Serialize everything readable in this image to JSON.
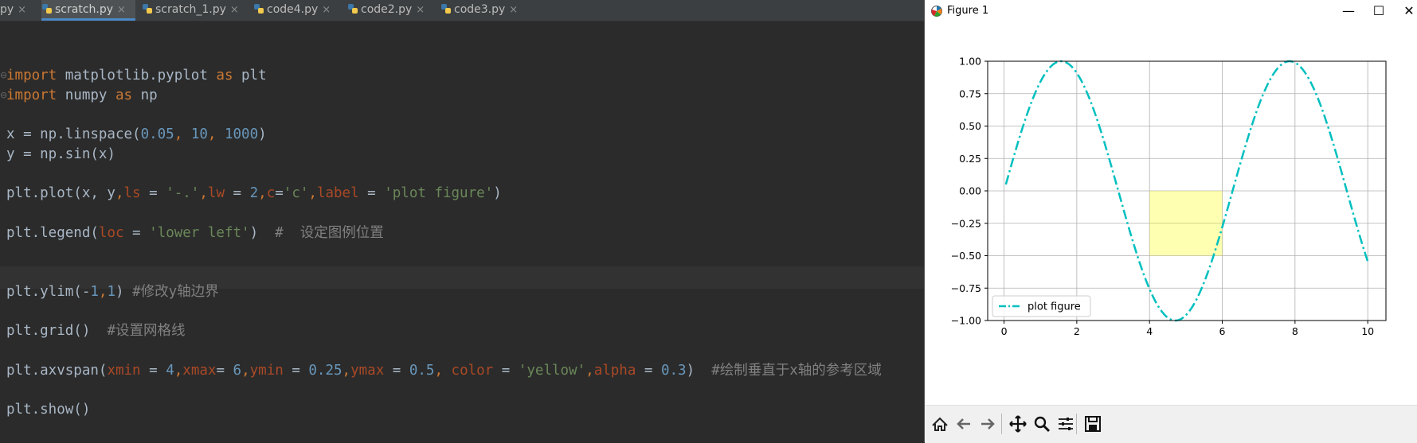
{
  "tabs": [
    {
      "label": "py",
      "icon": "python-file-icon",
      "active": false
    },
    {
      "label": "scratch.py",
      "icon": "python-file-icon",
      "active": true
    },
    {
      "label": "scratch_1.py",
      "icon": "python-file-icon",
      "active": false
    },
    {
      "label": "code4.py",
      "icon": "python-file-icon",
      "active": false
    },
    {
      "label": "code2.py",
      "icon": "python-file-icon",
      "active": false
    },
    {
      "label": "code3.py",
      "icon": "python-file-icon",
      "active": false
    }
  ],
  "tab_close_glyph": "×",
  "code_lines": [
    [
      [
        "kw",
        "import"
      ],
      [
        "t",
        " matplotlib.pyplot "
      ],
      [
        "kw",
        "as"
      ],
      [
        "t",
        " plt"
      ]
    ],
    [
      [
        "kw",
        "import"
      ],
      [
        "t",
        " numpy "
      ],
      [
        "kw",
        "as"
      ],
      [
        "t",
        " np"
      ]
    ],
    [],
    [
      [
        "t",
        "x = np.linspace("
      ],
      [
        "num",
        "0.05"
      ],
      [
        "kw",
        ", "
      ],
      [
        "num",
        "10"
      ],
      [
        "kw",
        ", "
      ],
      [
        "num",
        "1000"
      ],
      [
        "t",
        ")"
      ]
    ],
    [
      [
        "t",
        "y = np.sin(x)"
      ]
    ],
    [],
    [
      [
        "t",
        "plt.plot(x, y"
      ],
      [
        "kw",
        ","
      ],
      [
        "par",
        "ls"
      ],
      [
        "t",
        " = "
      ],
      [
        "str",
        "'-.'"
      ],
      [
        "kw",
        ","
      ],
      [
        "par",
        "lw"
      ],
      [
        "t",
        " = "
      ],
      [
        "num",
        "2"
      ],
      [
        "kw",
        ","
      ],
      [
        "par",
        "c"
      ],
      [
        "t",
        "="
      ],
      [
        "str",
        "'c'"
      ],
      [
        "kw",
        ","
      ],
      [
        "par",
        "label"
      ],
      [
        "t",
        " = "
      ],
      [
        "str",
        "'plot figure'"
      ],
      [
        "t",
        ")"
      ]
    ],
    [],
    [
      [
        "t",
        "plt.legend("
      ],
      [
        "par",
        "loc"
      ],
      [
        "t",
        " = "
      ],
      [
        "str",
        "'lower left'"
      ],
      [
        "t",
        ")  "
      ],
      [
        "cmt",
        "#  设定图例位置"
      ]
    ],
    [],
    [],
    [
      [
        "t",
        "plt.ylim(-"
      ],
      [
        "num",
        "1"
      ],
      [
        "kw",
        ","
      ],
      [
        "num",
        "1"
      ],
      [
        "t",
        ") "
      ],
      [
        "cmt",
        "#修改y轴边界"
      ]
    ],
    [],
    [
      [
        "t",
        "plt.grid()  "
      ],
      [
        "cmt",
        "#设置网格线"
      ]
    ],
    [],
    [
      [
        "t",
        "plt.axvspan("
      ],
      [
        "par",
        "xmin"
      ],
      [
        "t",
        " = "
      ],
      [
        "num",
        "4"
      ],
      [
        "kw",
        ","
      ],
      [
        "par",
        "xmax"
      ],
      [
        "t",
        "= "
      ],
      [
        "num",
        "6"
      ],
      [
        "kw",
        ","
      ],
      [
        "par",
        "ymin"
      ],
      [
        "t",
        " = "
      ],
      [
        "num",
        "0.25"
      ],
      [
        "kw",
        ","
      ],
      [
        "par",
        "ymax"
      ],
      [
        "t",
        " = "
      ],
      [
        "num",
        "0.5"
      ],
      [
        "kw",
        ", "
      ],
      [
        "par",
        "color"
      ],
      [
        "t",
        " = "
      ],
      [
        "str",
        "'yellow'"
      ],
      [
        "kw",
        ","
      ],
      [
        "par",
        "alpha"
      ],
      [
        "t",
        " = "
      ],
      [
        "num",
        "0.3"
      ],
      [
        "t",
        ")  "
      ],
      [
        "cmt",
        "#绘制垂直于x轴的参考区域"
      ]
    ],
    [],
    [
      [
        "t",
        "plt.show()"
      ]
    ]
  ],
  "figure": {
    "window_title": "Figure 1",
    "minimize_glyph": "—",
    "maximize_glyph": "☐",
    "close_glyph": "✕"
  },
  "chart_data": {
    "type": "line",
    "function": "sin(x)",
    "x": [
      0.05,
      0.5,
      1.0,
      1.5708,
      2.0,
      2.5,
      3.0,
      3.5,
      4.0,
      4.5,
      4.7124,
      5.0,
      5.5,
      6.0,
      6.5,
      7.0,
      7.5,
      7.854,
      8.0,
      8.5,
      9.0,
      9.5,
      10.0
    ],
    "series": [
      {
        "name": "plot figure",
        "color": "#00bfbf",
        "linestyle": "-.",
        "linewidth": 2,
        "values": [
          0.05,
          0.479,
          0.841,
          1.0,
          0.909,
          0.598,
          0.141,
          -0.351,
          -0.757,
          -0.978,
          -1.0,
          -0.959,
          -0.706,
          -0.279,
          0.215,
          0.657,
          0.938,
          1.0,
          0.989,
          0.798,
          0.412,
          -0.075,
          -0.544
        ]
      }
    ],
    "xlim": [
      -0.45,
      10.5
    ],
    "ylim": [
      -1.0,
      1.0
    ],
    "xticks": [
      "0",
      "2",
      "4",
      "6",
      "8",
      "10"
    ],
    "yticks": [
      "1.00",
      "0.75",
      "0.50",
      "0.25",
      "0.00",
      "−0.25",
      "−0.50",
      "−0.75",
      "−1.00"
    ],
    "grid": true,
    "legend": {
      "placement": "lower left",
      "entries": [
        "plot figure"
      ]
    },
    "axvspan": {
      "xmin": 4,
      "xmax": 6,
      "ymin": 0.25,
      "ymax": 0.5,
      "color": "#ffff00",
      "alpha": 0.3
    }
  },
  "toolbar": {
    "buttons": [
      "home-icon",
      "back-icon",
      "forward-icon",
      "pan-icon",
      "zoom-icon",
      "configure-subplots-icon",
      "save-icon"
    ]
  }
}
